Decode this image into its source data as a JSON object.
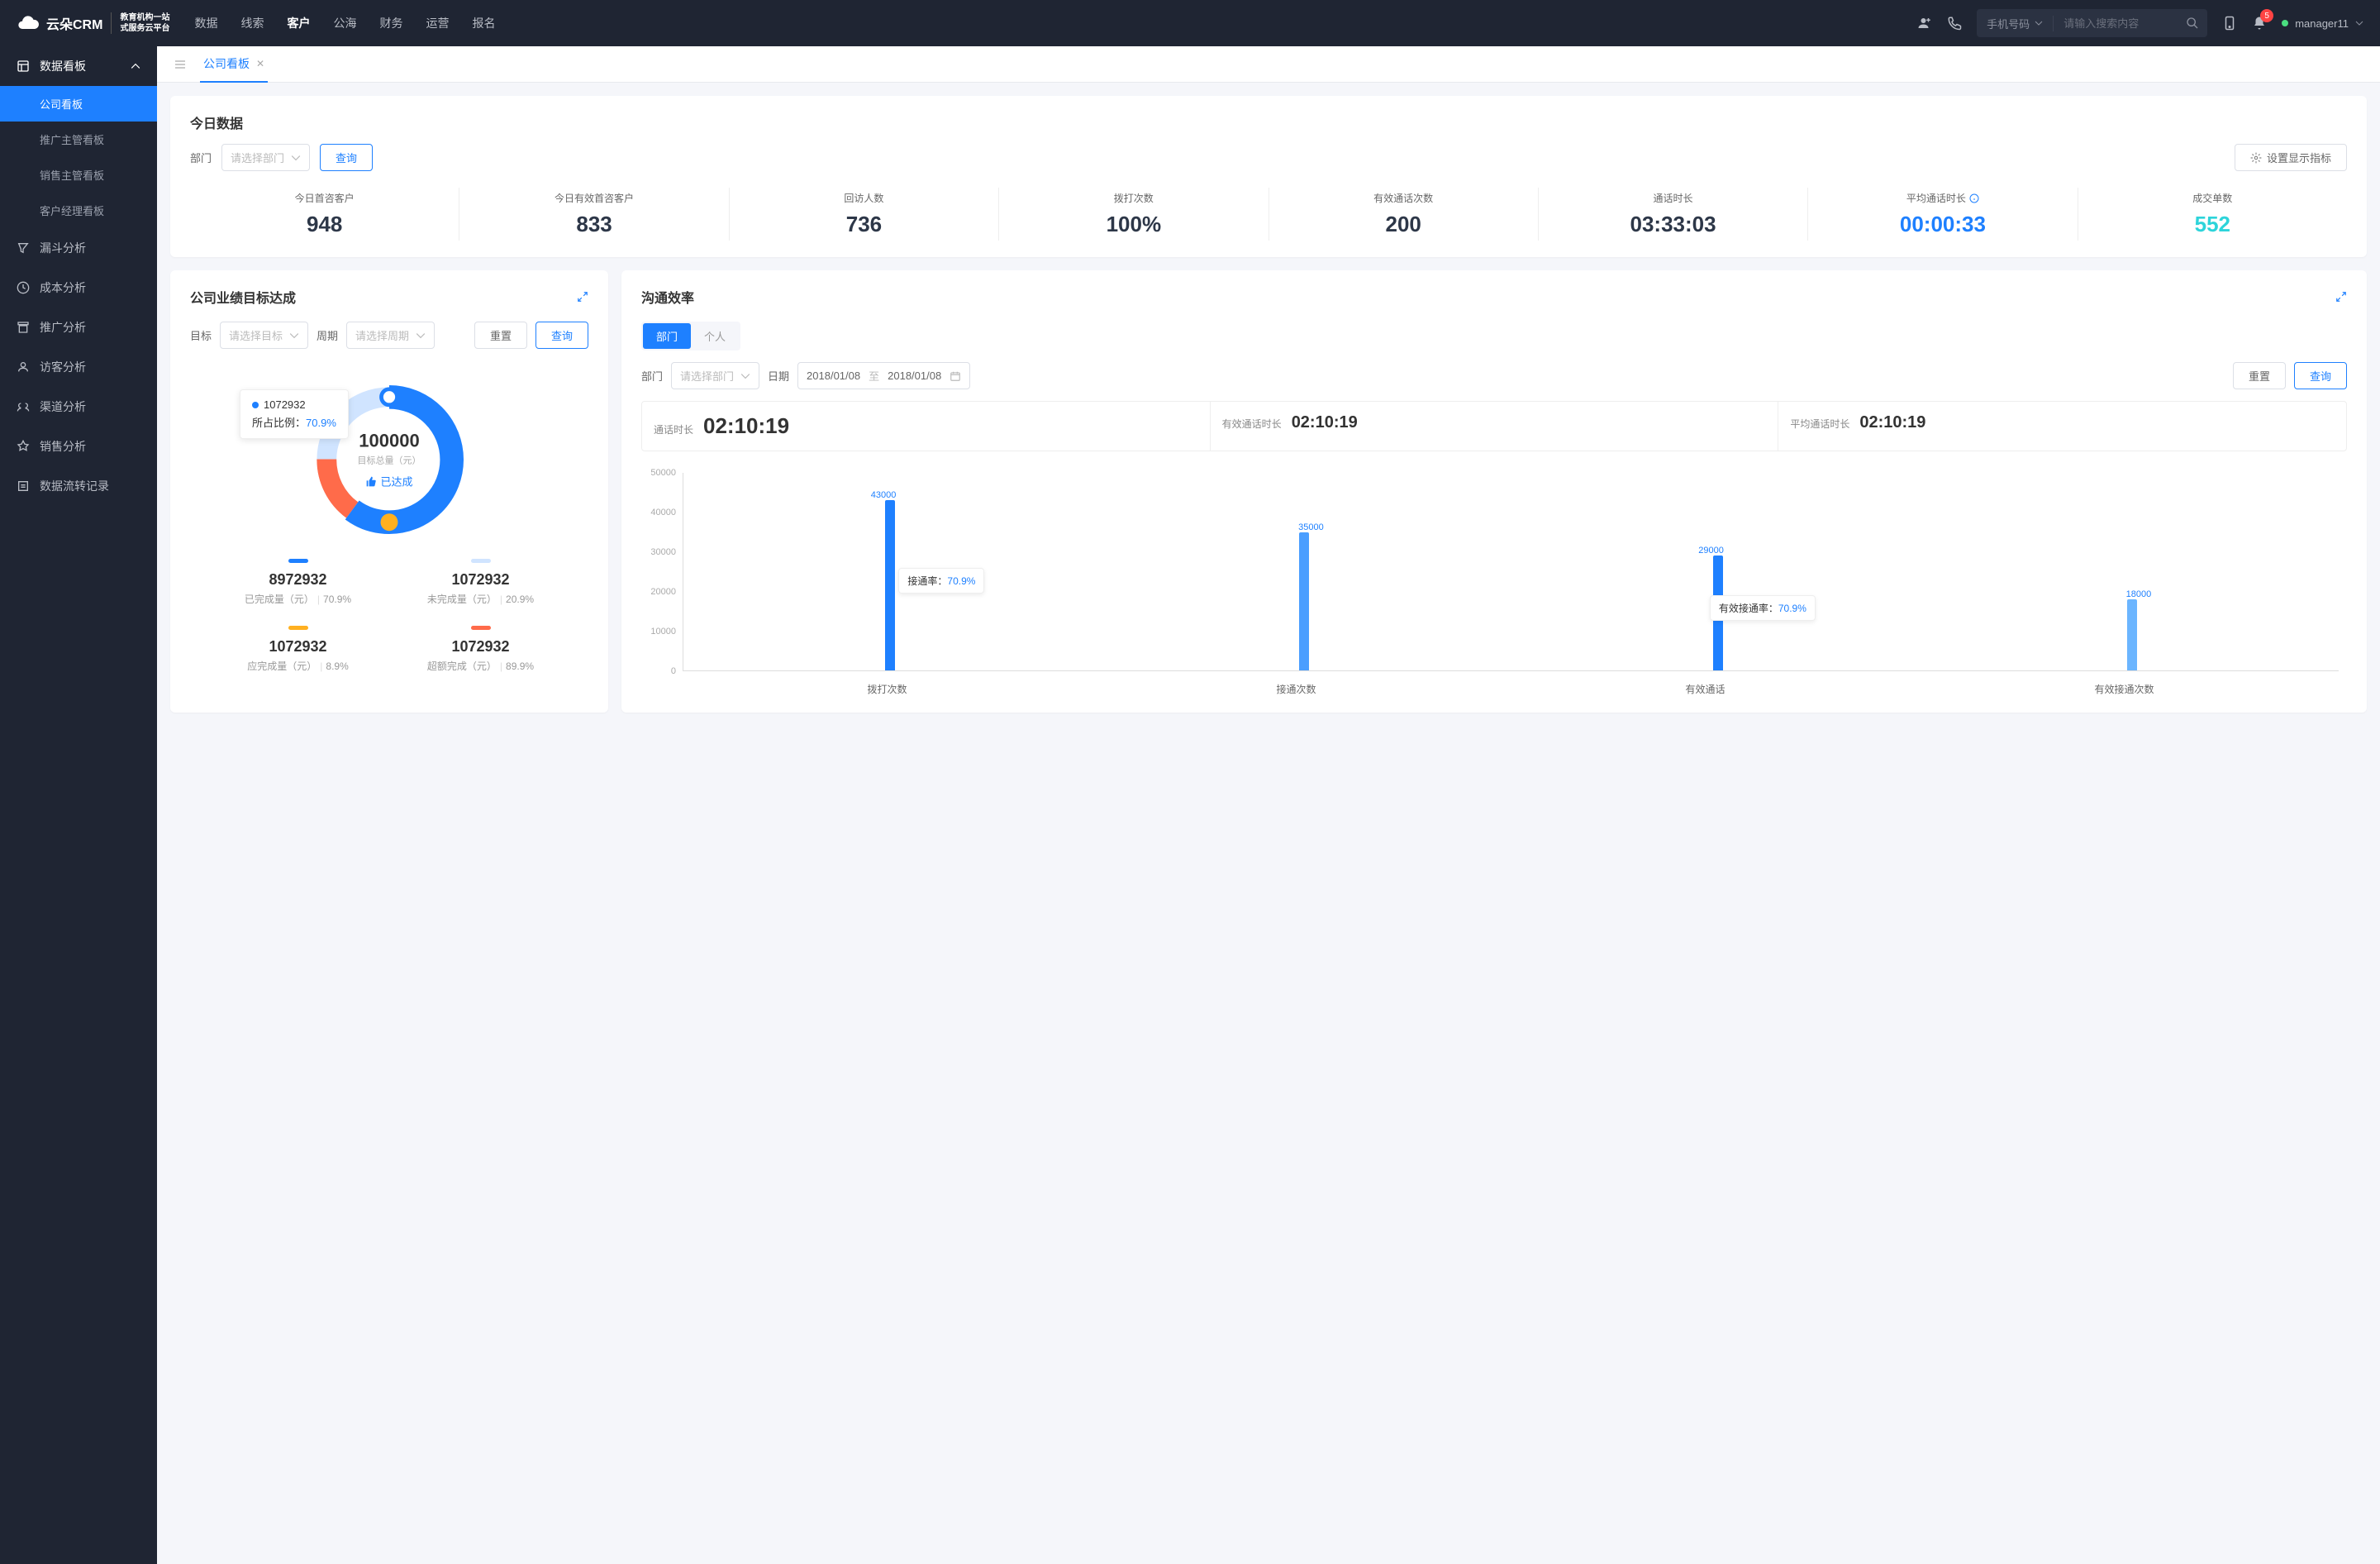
{
  "logo": {
    "title": "云朵CRM",
    "sub1": "教育机构一站",
    "sub2": "式服务云平台"
  },
  "topnav": [
    "数据",
    "线索",
    "客户",
    "公海",
    "财务",
    "运营",
    "报名"
  ],
  "topnav_active": 2,
  "search": {
    "type": "手机号码",
    "placeholder": "请输入搜索内容"
  },
  "notif_count": "5",
  "user": "manager11",
  "sidebar": {
    "group": "数据看板",
    "items": [
      "公司看板",
      "推广主管看板",
      "销售主管看板",
      "客户经理看板"
    ],
    "single_items": [
      "漏斗分析",
      "成本分析",
      "推广分析",
      "访客分析",
      "渠道分析",
      "销售分析",
      "数据流转记录"
    ]
  },
  "tab": {
    "label": "公司看板"
  },
  "today": {
    "title": "今日数据",
    "dept_label": "部门",
    "dept_placeholder": "请选择部门",
    "query": "查询",
    "settings": "设置显示指标",
    "metrics": [
      {
        "label": "今日首咨客户",
        "value": "948",
        "cls": ""
      },
      {
        "label": "今日有效首咨客户",
        "value": "833",
        "cls": ""
      },
      {
        "label": "回访人数",
        "value": "736",
        "cls": ""
      },
      {
        "label": "拨打次数",
        "value": "100%",
        "cls": ""
      },
      {
        "label": "有效通话次数",
        "value": "200",
        "cls": ""
      },
      {
        "label": "通话时长",
        "value": "03:33:03",
        "cls": ""
      },
      {
        "label": "平均通话时长",
        "value": "00:00:33",
        "cls": "blue",
        "info": true
      },
      {
        "label": "成交单数",
        "value": "552",
        "cls": "cyan"
      }
    ]
  },
  "target_card": {
    "title": "公司业绩目标达成",
    "target_label": "目标",
    "target_ph": "请选择目标",
    "period_label": "周期",
    "period_ph": "请选择周期",
    "reset": "重置",
    "query": "查询",
    "tooltip": {
      "val": "1072932",
      "pct_label": "所占比例：",
      "pct": "70.9%"
    },
    "center": {
      "num": "100000",
      "sub": "目标总量（元）",
      "status": "已达成"
    },
    "legend": [
      {
        "color": "#1e80ff",
        "num": "8972932",
        "txt": "已完成量（元）",
        "pct": "70.9%"
      },
      {
        "color": "#d0e4ff",
        "num": "1072932",
        "txt": "未完成量（元）",
        "pct": "20.9%"
      },
      {
        "color": "#ffb020",
        "num": "1072932",
        "txt": "应完成量（元）",
        "pct": "8.9%"
      },
      {
        "color": "#ff6b4a",
        "num": "1072932",
        "txt": "超额完成（元）",
        "pct": "89.9%"
      }
    ]
  },
  "comm_card": {
    "title": "沟通效率",
    "seg": [
      "部门",
      "个人"
    ],
    "dept_label": "部门",
    "dept_ph": "请选择部门",
    "date_label": "日期",
    "date_from": "2018/01/08",
    "date_to": "2018/01/08",
    "date_sep": "至",
    "reset": "重置",
    "query": "查询",
    "stats": [
      {
        "label": "通话时长",
        "value": "02:10:19",
        "big": true
      },
      {
        "label": "有效通话时长",
        "value": "02:10:19"
      },
      {
        "label": "平均通话时长",
        "value": "02:10:19"
      }
    ],
    "anno1": {
      "label": "接通率：",
      "pct": "70.9%"
    },
    "anno2": {
      "label": "有效接通率：",
      "pct": "70.9%"
    }
  },
  "chart_data": [
    {
      "type": "pie",
      "title": "公司业绩目标达成",
      "series": [
        {
          "name": "已完成量（元）",
          "value": 8972932,
          "pct": 70.9,
          "color": "#1e80ff"
        },
        {
          "name": "未完成量（元）",
          "value": 1072932,
          "pct": 20.9,
          "color": "#d0e4ff"
        },
        {
          "name": "超额完成（元）",
          "value": 1072932,
          "pct": 89.9,
          "color": "#ff6b4a"
        }
      ],
      "center_label": "目标总量（元）",
      "center_value": 100000
    },
    {
      "type": "bar",
      "title": "沟通效率",
      "categories": [
        "拨打次数",
        "接通次数",
        "有效通话",
        "有效接通次数"
      ],
      "values": [
        43000,
        35000,
        29000,
        18000
      ],
      "ylabel": "",
      "ylim": [
        0,
        50000
      ],
      "y_ticks": [
        0,
        10000,
        20000,
        30000,
        40000,
        50000
      ],
      "annotations": [
        {
          "label": "接通率",
          "value": "70.9%"
        },
        {
          "label": "有效接通率",
          "value": "70.9%"
        }
      ]
    }
  ]
}
